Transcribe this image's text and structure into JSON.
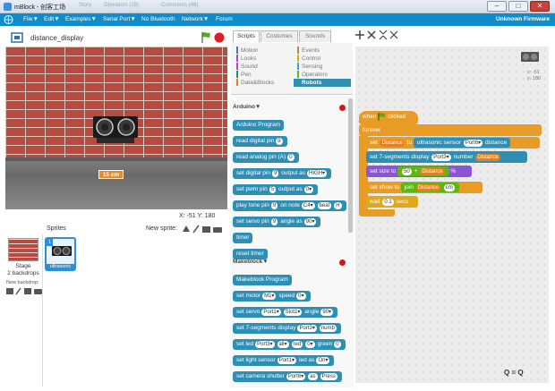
{
  "window": {
    "title": "mBlock - 创客工场",
    "ghost_tabs": [
      "Story",
      "Operators (18)",
      "Comments (48)"
    ],
    "minimize": "‒",
    "maximize": "□",
    "close": "✕"
  },
  "menu": {
    "items": [
      "File▼",
      "Edit▼",
      "Examples▼",
      "Serial Port▼",
      "No Bluetooth",
      "Network▼",
      "Forum"
    ],
    "firmware": "Unknown Firmware"
  },
  "stage": {
    "name": "distance_display",
    "distance_label": "15 cm",
    "x_readout": "X: -51",
    "y_readout": "Y: 180"
  },
  "sprites": {
    "header": "Sprites",
    "new_sprite": "New sprite:",
    "stage_label": "Stage",
    "stage_backdrops": "2 backdrops",
    "new_backdrop": "New backdrop:",
    "sprite_name": "ultrasonic",
    "sprite_number": "1"
  },
  "tabs": [
    "Scripts",
    "Costumes",
    "Sounds"
  ],
  "categories": {
    "left": [
      "Motion",
      "Looks",
      "Sound",
      "Pen",
      "Data&Blocks"
    ],
    "right": [
      "Events",
      "Control",
      "Sensing",
      "Operators",
      "Robots"
    ],
    "left_colors": [
      "#4a6cd4",
      "#8a55d7",
      "#bb42c3",
      "#0e9a6c",
      "#ee7d16"
    ],
    "right_colors": [
      "#c88330",
      "#e1a91a",
      "#2ca5e2",
      "#5cb712",
      "#2e8fb4"
    ]
  },
  "palette": {
    "arduino_section": "Arduino▼",
    "makeblock_section": "Makeblock▼",
    "arduino_blocks": [
      {
        "text": "Arduino Program",
        "slots": []
      },
      {
        "text": "read digital pin",
        "slots": [
          "9"
        ]
      },
      {
        "text": "read analog pin (A)",
        "slots": [
          "0"
        ]
      },
      {
        "text": "set digital pin",
        "slots": [
          "9",
          "output as",
          "HIGH▾"
        ]
      },
      {
        "text": "set pwm pin",
        "slots": [
          "5",
          "output as",
          "0▾"
        ]
      },
      {
        "text": "play tone pin",
        "slots": [
          "9",
          "on note",
          "C4▾",
          "beat",
          "H"
        ]
      },
      {
        "text": "set servo pin",
        "slots": [
          "9",
          "angle as",
          "90▾"
        ]
      },
      {
        "text": "timer",
        "slots": []
      },
      {
        "text": "reset timer",
        "slots": []
      }
    ],
    "makeblock_blocks": [
      {
        "text": "Makeblock Program",
        "slots": []
      },
      {
        "text": "set motor",
        "slots": [
          "M1▾",
          "speed",
          "0▾"
        ]
      },
      {
        "text": "set servo",
        "slots": [
          "Port1▾",
          "Slot1▾",
          "angle",
          "90▾"
        ]
      },
      {
        "text": "set 7-segments display",
        "slots": [
          "Port3▾",
          "numb"
        ]
      },
      {
        "text": "set led",
        "slots": [
          "Port3▾",
          "all▾",
          "red",
          "0▾",
          "green",
          "0"
        ]
      },
      {
        "text": "set light sensor",
        "slots": [
          "Port1▾",
          "led as",
          "On▾"
        ]
      },
      {
        "text": "set camera shutter",
        "slots": [
          "Port6▾",
          "as",
          "Press"
        ]
      }
    ]
  },
  "script": {
    "hat_when": "when",
    "hat_clicked": "clicked",
    "forever": "forever",
    "set_label": "set",
    "distance_var": "Distance",
    "to_label": "to",
    "sensor_text": "ultrasonic sensor",
    "sensor_port": "Port6▾",
    "sensor_distance": "distance",
    "seg_text": "set 7-segments display",
    "seg_port": "Port3▾",
    "seg_number": "number",
    "size_text": "set size to",
    "size_value": "50",
    "plus": "+",
    "percent": "%",
    "show_text": "set show",
    "join_text": "join",
    "cm_value": "cm",
    "wait_text": "wait",
    "wait_value": "0.1",
    "secs": "secs",
    "sprite_x": "x: -51",
    "sprite_y": "y: 180",
    "zoom": "Q = Q"
  }
}
